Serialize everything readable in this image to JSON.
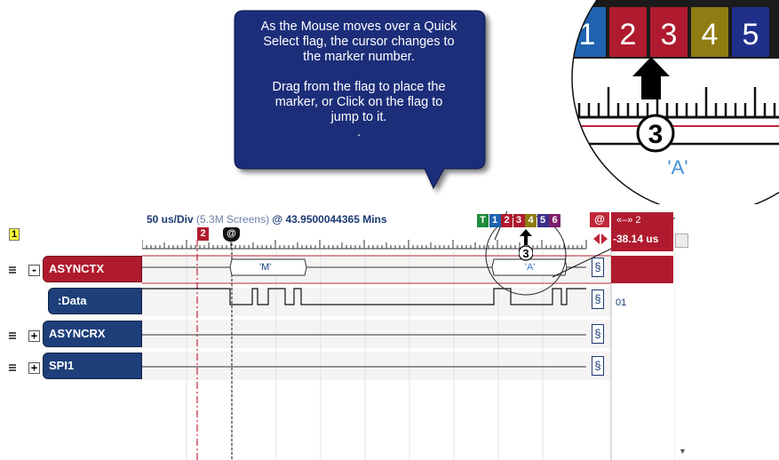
{
  "callout": {
    "line1": "As the Mouse moves over a Quick",
    "line2": "Select flag, the cursor changes to",
    "line3": "the marker number.",
    "line4": "Drag from the flag to place the",
    "line5": "marker, or Click on the flag to",
    "line6": "jump to it.",
    "line7": "."
  },
  "group_badge": "1",
  "header": {
    "timebase": "50 us/Div",
    "screens": "(5.3M Screens)",
    "position": "@ 43.9500044365 Mins"
  },
  "quick_flags": [
    "T",
    "1",
    "2",
    "3",
    "4",
    "5",
    "6"
  ],
  "quick_flag_colors": [
    "#1f8a3a",
    "#1f63b0",
    "#b01a2e",
    "#b01a2e",
    "#8f7c12",
    "#3b2f8a",
    "#7a1f6b"
  ],
  "marker_flag_2": "2",
  "marker_flag_at": "@",
  "at_button": "@",
  "range": {
    "top": "«–» 2",
    "value": "-38.14 us"
  },
  "signals": [
    {
      "name": "ASYNCTX",
      "expander": "-",
      "value": ""
    },
    {
      "name": ":Data",
      "expander": "",
      "value": "01"
    },
    {
      "name": "ASYNCRX",
      "expander": "+",
      "value": ""
    },
    {
      "name": "SPI1",
      "expander": "+",
      "value": ""
    }
  ],
  "bus_labels": {
    "m": "'M'",
    "a": "'A'"
  },
  "cursor_number": "3",
  "magnifier": {
    "flags": [
      "1",
      "2",
      "3",
      "4",
      "5"
    ],
    "flag_colors": [
      "#1f63b0",
      "#b01a2e",
      "#b01a2e",
      "#8f7c12",
      "#1f2f8a"
    ],
    "cursor_number": "3",
    "bus_label": "'A'"
  },
  "colors": {
    "callout_bg": "#1c2d7a",
    "accent_red": "#b01a2e",
    "signal_blue": "#1e3f7a"
  }
}
